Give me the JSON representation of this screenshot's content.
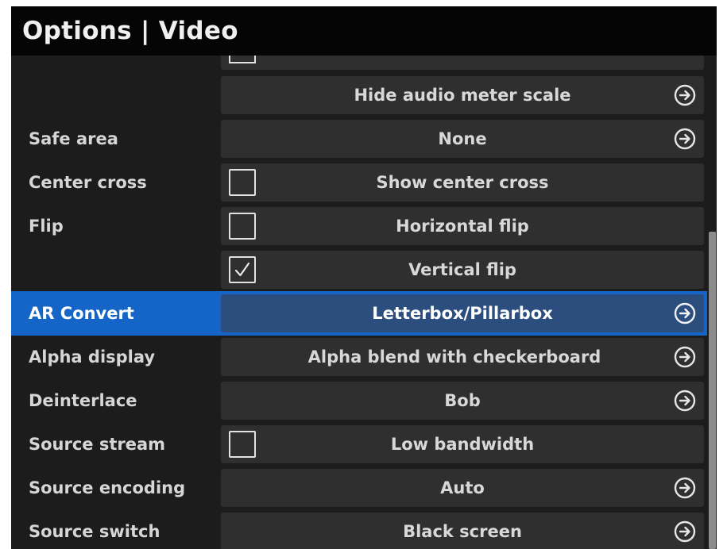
{
  "window": {
    "title": "Options | Video"
  },
  "rows": [
    {
      "label": "",
      "control_text": "Hide audio meter scale",
      "control_type": "arrow",
      "icon": "circle-arrow-right-icon"
    },
    {
      "label": "Safe area",
      "control_text": "None",
      "control_type": "arrow",
      "icon": "circle-arrow-right-icon"
    },
    {
      "label": "Center cross",
      "control_text": "Show center cross",
      "control_type": "checkbox",
      "checked": false
    },
    {
      "label": "Flip",
      "control_text": "Horizontal flip",
      "control_type": "checkbox",
      "checked": false
    },
    {
      "label": "",
      "control_text": "Vertical flip",
      "control_type": "checkbox",
      "checked": true
    },
    {
      "label": "AR Convert",
      "control_text": "Letterbox/Pillarbox",
      "control_type": "arrow",
      "icon": "circle-arrow-right-icon",
      "selected": true
    },
    {
      "label": "Alpha display",
      "control_text": "Alpha blend with checkerboard",
      "control_type": "arrow",
      "icon": "circle-arrow-right-icon"
    },
    {
      "label": "Deinterlace",
      "control_text": "Bob",
      "control_type": "arrow",
      "icon": "circle-arrow-right-icon"
    },
    {
      "label": "Source stream",
      "control_text": "Low bandwidth",
      "control_type": "checkbox",
      "checked": false
    },
    {
      "label": "Source encoding",
      "control_text": "Auto",
      "control_type": "arrow",
      "icon": "circle-arrow-right-icon"
    },
    {
      "label": "Source switch",
      "control_text": "Black screen",
      "control_type": "arrow",
      "icon": "circle-arrow-right-icon"
    }
  ],
  "colors": {
    "panel_bg": "#1c1c1c",
    "title_bg": "#050505",
    "control_bg": "#2f2f2f",
    "selected_row": "#1565c8",
    "selected_control": "#2b4e7e",
    "text": "#d6d6d6"
  }
}
